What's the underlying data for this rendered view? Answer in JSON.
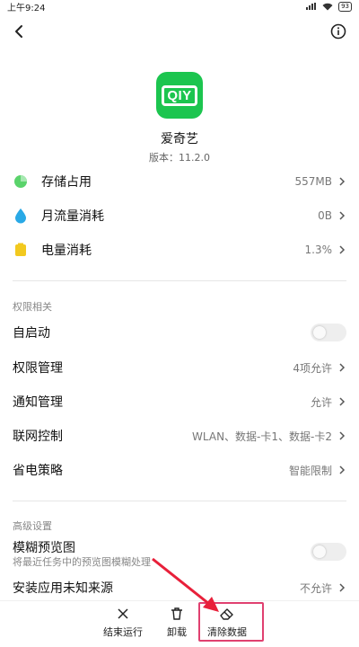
{
  "status": {
    "time": "上午9:24",
    "battery": "93"
  },
  "app": {
    "name": "爱奇艺",
    "version": "版本：11.2.0",
    "logo_text": "QIY"
  },
  "usage": [
    {
      "label": "存储占用",
      "value": "557MB",
      "color": "#5ad36b"
    },
    {
      "label": "月流量消耗",
      "value": "0B",
      "color": "#29a9e6"
    },
    {
      "label": "电量消耗",
      "value": "1.3%",
      "color": "#f2c91f"
    }
  ],
  "permissions": {
    "title": "权限相关",
    "items": [
      {
        "label": "自启动",
        "value": ""
      },
      {
        "label": "权限管理",
        "value": "4项允许"
      },
      {
        "label": "通知管理",
        "value": "允许"
      },
      {
        "label": "联网控制",
        "value": "WLAN、数据-卡1、数据-卡2"
      },
      {
        "label": "省电策略",
        "value": "智能限制"
      }
    ]
  },
  "advanced": {
    "title": "高级设置",
    "blur_label": "模糊预览图",
    "blur_desc": "将最近任务中的预览图模糊处理",
    "unknown_label": "安装应用未知来源",
    "unknown_value": "不允许"
  },
  "bottom": {
    "stop": "结束运行",
    "uninstall": "卸载",
    "clear": "清除数据"
  },
  "colors": {
    "accent_highlight": "#e04070",
    "arrow": "#e8203a"
  }
}
